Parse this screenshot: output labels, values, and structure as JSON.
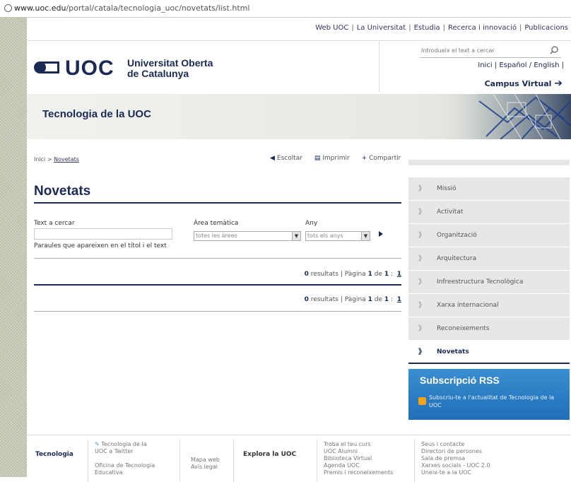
{
  "browser": {
    "url_host": "www.uoc.edu",
    "url_path": "/portal/catala/tecnologia_uoc/novetats/list.html"
  },
  "topnav": {
    "items": [
      "Web UOC",
      "La Universitat",
      "Estudia",
      "Recerca i innovació",
      "Publicacions"
    ]
  },
  "brand": {
    "logo_text": "UOC",
    "name_line1": "Universitat Oberta",
    "name_line2": "de Catalunya"
  },
  "search": {
    "placeholder": "Introdueix el text a cercar"
  },
  "lang": {
    "inici": "Inici",
    "espanol": "Español",
    "english": "English"
  },
  "campus": {
    "label": "Campus Virtual"
  },
  "banner": {
    "title": "Tecnologia de la UOC"
  },
  "breadcrumb": {
    "home": "Inici",
    "current": "Novetats"
  },
  "actions": {
    "listen": "Escoltar",
    "print": "Imprimir",
    "share": "Compartir"
  },
  "main": {
    "title": "Novetats",
    "form": {
      "text_label": "Text a cercar",
      "text_help": "Paraules que apareixen en el títol i el text",
      "area_label": "Àrea temàtica",
      "area_value": "totes les àrees",
      "year_label": "Any",
      "year_value": "tots els anys"
    },
    "results": [
      {
        "count": "0",
        "text_resultats": "resultats",
        "text_pagina": "Pàgina",
        "page": "1",
        "text_de": "de",
        "total": "1",
        "link": "1"
      },
      {
        "count": "0",
        "text_resultats": "resultats",
        "text_pagina": "Pàgina",
        "page": "1",
        "text_de": "de",
        "total": "1",
        "link": "1"
      }
    ]
  },
  "sidebar": {
    "items": [
      {
        "label": "Missió"
      },
      {
        "label": "Activitat"
      },
      {
        "label": "Organització"
      },
      {
        "label": "Arquitectura"
      },
      {
        "label": "Infreestructura Tecnològica"
      },
      {
        "label": "Xarxa internacional"
      },
      {
        "label": "Reconeixements"
      },
      {
        "label": "Novetats"
      }
    ],
    "active_index": 7
  },
  "rss": {
    "title": "Subscripció RSS",
    "text": "Subscriu-te a l'actualitat de Tecnologia de la UOC"
  },
  "footer": {
    "section_title": "Tecnologia",
    "twitter_line1": "Tecnologia de la",
    "twitter_line2": "UOC a Twitter",
    "office_line1": "Oficina de Tecnologia",
    "office_line2": "Educativa",
    "mapa": "Mapa web",
    "avis": "Avís legal",
    "explora": "Explora la UOC",
    "links_a": [
      "Troba el teu curs",
      "UOC Alumni",
      "Biblioteca Virtual",
      "Agenda UOC",
      "Premis i reconeixements"
    ],
    "links_b": [
      "Seus i contacte",
      "Directori de persones",
      "Sala de premsa",
      "Xarxes socials - UOC 2.0",
      "Uneix-te a la UOC"
    ]
  },
  "colors": {
    "brand_navy": "#1a2a55",
    "rss_blue": "#2a7fc4"
  }
}
